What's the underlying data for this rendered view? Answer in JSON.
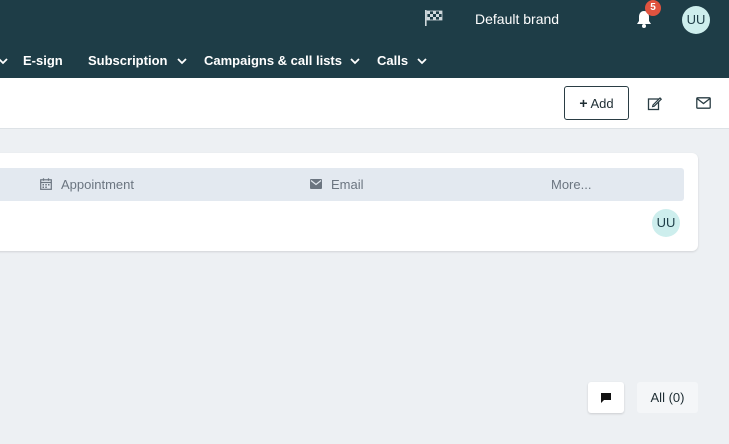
{
  "header": {
    "brand": "Default brand",
    "notification_count": "5",
    "user_initials": "UU"
  },
  "nav": {
    "items": [
      {
        "label": "E-sign"
      },
      {
        "label": "Subscription"
      },
      {
        "label": "Campaigns & call lists"
      },
      {
        "label": "Calls"
      }
    ]
  },
  "toolbar": {
    "add_label": "Add"
  },
  "activity_tabs": {
    "appointment": "Appointment",
    "email": "Email",
    "more": "More..."
  },
  "activity_row": {
    "user_initials": "UU"
  },
  "footer": {
    "all_label": "All (0)"
  },
  "colors": {
    "header_bg": "#1e3d47",
    "badge": "#e0533f",
    "avatar_bg": "#cdeeed"
  }
}
